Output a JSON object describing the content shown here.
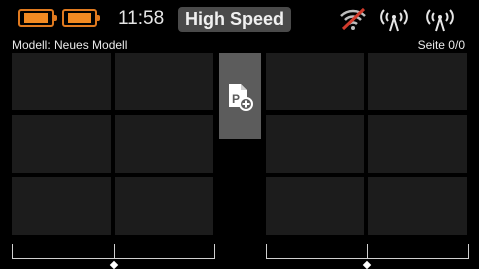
{
  "status": {
    "time": "11:58",
    "mode": "High Speed",
    "icons": [
      "battery-icon",
      "battery-icon",
      "wifi-off-icon",
      "antenna-icon",
      "antenna-icon"
    ],
    "colors": {
      "battery": "#f28a22",
      "wifi_off": "#d23b2c",
      "mode_bg": "#4a4a4a"
    }
  },
  "subheader": {
    "model": "Modell: Neues Modell",
    "page": "Seite 0/0"
  },
  "grid": {
    "icon": "add-page-p-icon"
  }
}
